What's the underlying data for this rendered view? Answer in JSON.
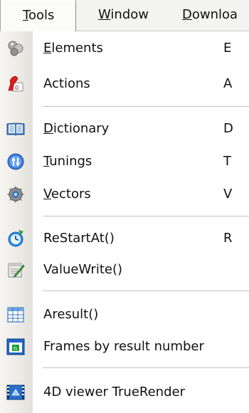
{
  "menubar": {
    "items": [
      {
        "pre": "",
        "ul": "T",
        "post": "ools"
      },
      {
        "pre": "",
        "ul": "W",
        "post": "indow"
      },
      {
        "pre": "",
        "ul": "D",
        "post": "ownloa"
      }
    ]
  },
  "menu": {
    "items": [
      {
        "icon": "elements-icon",
        "pre": "",
        "ul": "E",
        "post": "lements",
        "shortcut": "E"
      },
      {
        "icon": "actions-icon",
        "pre": "Actions",
        "ul": "",
        "post": "",
        "shortcut": "A"
      },
      {
        "icon": "dictionary-icon",
        "pre": "",
        "ul": "D",
        "post": "ictionary",
        "shortcut": "D"
      },
      {
        "icon": "tunings-icon",
        "pre": "",
        "ul": "T",
        "post": "unings",
        "shortcut": "T"
      },
      {
        "icon": "vectors-icon",
        "pre": "",
        "ul": "V",
        "post": "ectors",
        "shortcut": "V"
      },
      {
        "icon": "restart-icon",
        "pre": "ReStartAt()",
        "ul": "",
        "post": "",
        "shortcut": "R"
      },
      {
        "icon": "value-write-icon",
        "pre": "ValueWrite()",
        "ul": "",
        "post": "",
        "shortcut": ""
      },
      {
        "icon": "table-icon",
        "pre": "Aresult()",
        "ul": "",
        "post": "",
        "shortcut": ""
      },
      {
        "icon": "frames-icon",
        "pre": "Frames by result number",
        "ul": "",
        "post": "",
        "shortcut": ""
      },
      {
        "icon": "viewer-4d-icon",
        "pre": "4D viewer TrueRender",
        "ul": "",
        "post": "",
        "shortcut": ""
      }
    ]
  }
}
